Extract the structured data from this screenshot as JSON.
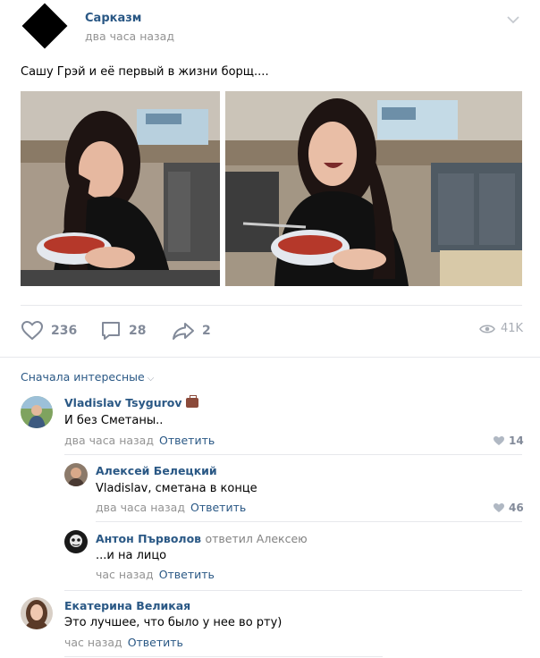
{
  "post": {
    "group_name": "Сарказм",
    "time": "два часа назад",
    "text": "Сашу Грэй и её первый в жизни борщ....",
    "menu_icon": "chevron-down-icon"
  },
  "actions": {
    "likes": "236",
    "comments": "28",
    "shares": "2",
    "views": "41K"
  },
  "comments": {
    "sort_label": "Сначала интересные",
    "items": [
      {
        "author": "Vladislav Tsygurov",
        "badge_icon": "briefcase-icon",
        "text": "И без Сметаны..",
        "time": "два часа назад",
        "reply_label": "Ответить",
        "likes": "14"
      },
      {
        "author": "Алексей Белецкий",
        "text": "Vladislav, сметана в конце",
        "time": "два часа назад",
        "reply_label": "Ответить",
        "likes": "46"
      },
      {
        "author": "Антон Първолов",
        "replied_to": "ответил Алексею",
        "text": "...и на лицо",
        "time": "час назад",
        "reply_label": "Ответить"
      },
      {
        "author": "Екатерина Великая",
        "text": "Это лучшее, что было у нее во рту)",
        "time": "час назад",
        "reply_label": "Ответить"
      }
    ]
  },
  "colors": {
    "link": "#2a5885",
    "muted": "#939393",
    "icon": "#828a99"
  }
}
